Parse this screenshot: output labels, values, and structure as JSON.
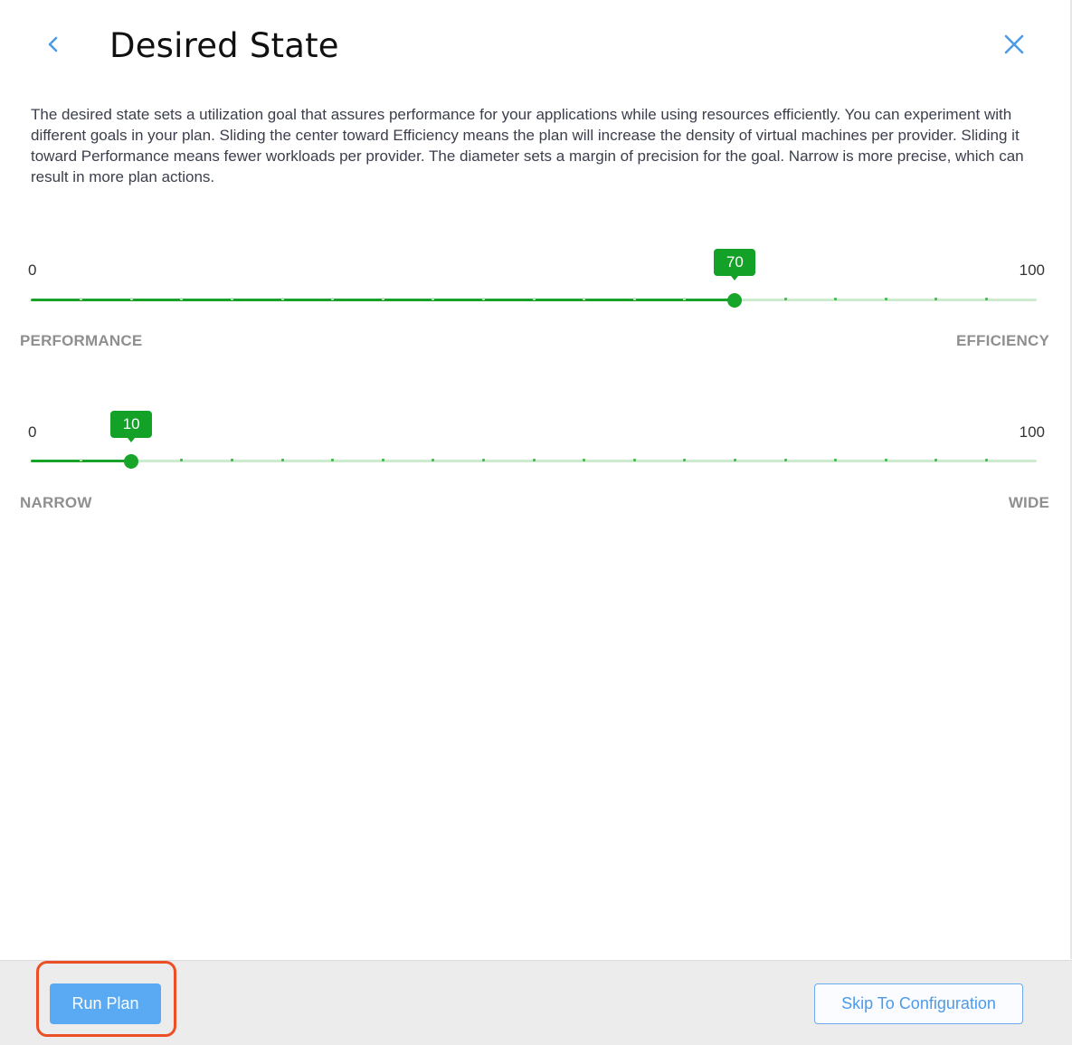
{
  "header": {
    "title": "Desired State",
    "back_icon": "chevron-left-icon",
    "close_icon": "close-icon"
  },
  "description": "The desired state sets a utilization goal that assures performance for your applications while using resources efficiently. You can experiment with different goals in your plan. Sliding the center toward Efficiency means the plan will increase the density of virtual machines per provider. Sliding it toward Performance means fewer workloads per provider. The diameter sets a margin of precision for the goal. Narrow is more precise, which can result in more plan actions.",
  "sliders": [
    {
      "min": "0",
      "max": "100",
      "value": "70",
      "left_label": "PERFORMANCE",
      "right_label": "EFFICIENCY"
    },
    {
      "min": "0",
      "max": "100",
      "value": "10",
      "left_label": "NARROW",
      "right_label": "WIDE"
    }
  ],
  "footer": {
    "run_plan": "Run Plan",
    "skip": "Skip To Configuration"
  },
  "colors": {
    "accent_green": "#17a52a",
    "accent_blue": "#5aaaf3",
    "highlight": "#ec4e25"
  }
}
